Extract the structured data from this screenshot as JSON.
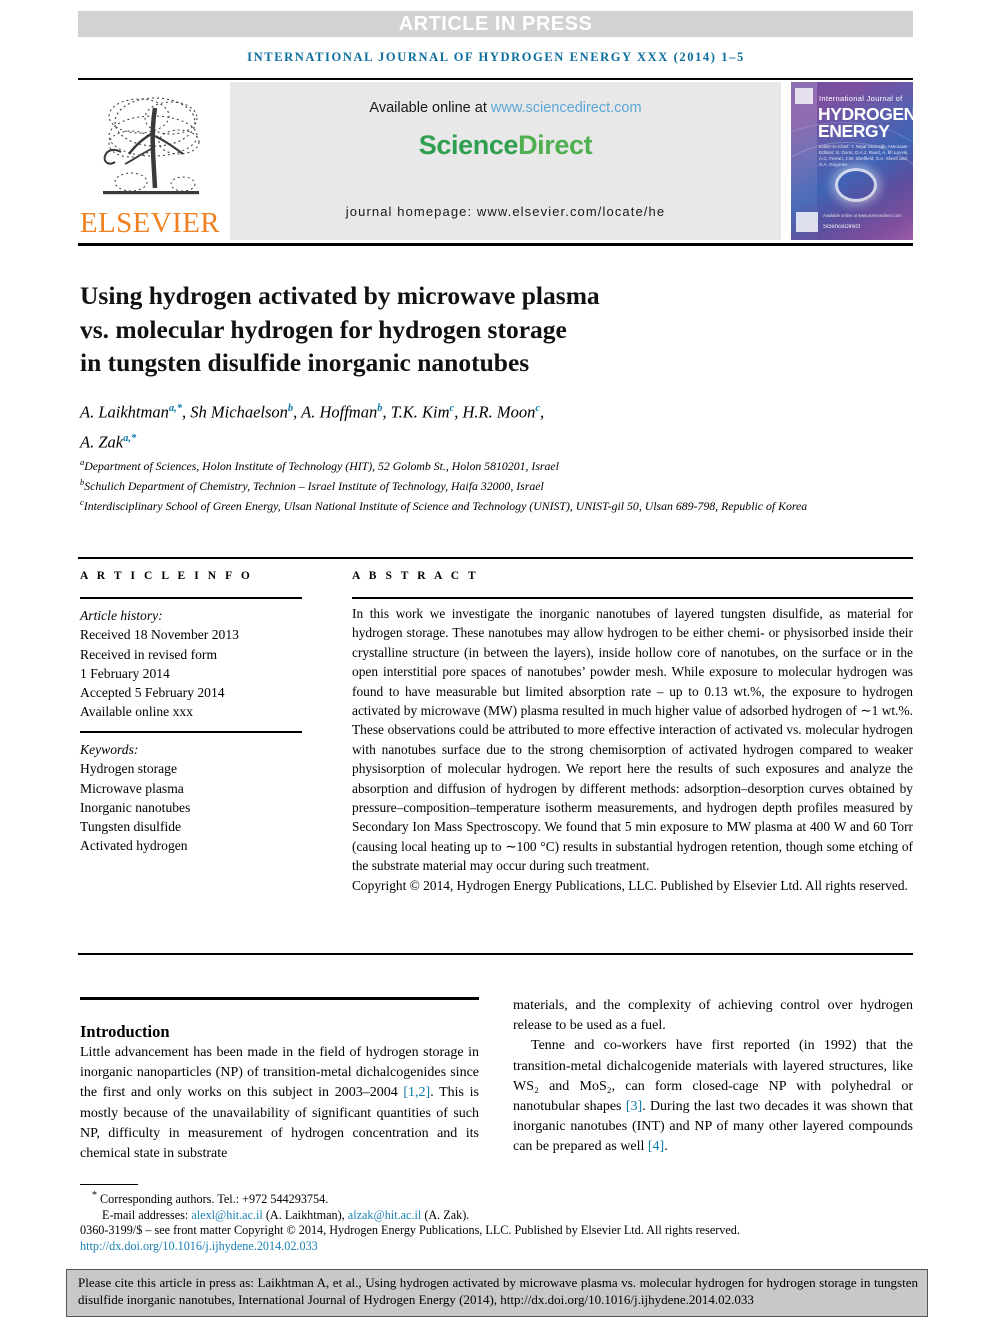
{
  "banner": {
    "article_in_press": "ARTICLE IN PRESS",
    "running_head": "INTERNATIONAL JOURNAL OF HYDROGEN ENERGY XXX (2014) 1–5"
  },
  "masthead": {
    "publisher_name": "ELSEVIER",
    "available_prefix": "Available online at ",
    "available_link": "www.sciencedirect.com",
    "brand_first": "Science",
    "brand_second": "Direct",
    "homepage": "journal homepage: www.elsevier.com/locate/he",
    "cover": {
      "eyebrow": "International Journal of",
      "title_line1": "HYDROGEN",
      "title_line2": "ENERGY",
      "meta": "Editor-in-Chief: T. Nejat Veziroğlu\nAssociate Editors: S. Dunn, D.A.J. Rand, A. M. Lovvik, A.C. Ferrari, J.W. Sheffield, S.A. Sherif and S.A. Grigoriev",
      "footer_brand": "ScienceDirect",
      "footer_note": "Available online at www.sciencedirect.com"
    }
  },
  "article": {
    "title_lines": [
      "Using hydrogen activated by microwave plasma",
      "vs. molecular hydrogen for hydrogen storage",
      "in tungsten disulfide inorganic nanotubes"
    ],
    "authors": [
      {
        "name": "A. Laikhtman",
        "marks": "a,*"
      },
      {
        "name": "Sh Michaelson",
        "marks": "b"
      },
      {
        "name": "A. Hoffman",
        "marks": "b"
      },
      {
        "name": "T.K. Kim",
        "marks": "c"
      },
      {
        "name": "H.R. Moon",
        "marks": "c"
      },
      {
        "name": "A. Zak",
        "marks": "a,*"
      }
    ],
    "affiliations": [
      {
        "mark": "a",
        "text": "Department of Sciences, Holon Institute of Technology (HIT), 52 Golomb St., Holon 5810201, Israel"
      },
      {
        "mark": "b",
        "text": "Schulich Department of Chemistry, Technion – Israel Institute of Technology, Haifa 32000, Israel"
      },
      {
        "mark": "c",
        "text": "Interdisciplinary School of Green Energy, Ulsan National Institute of Science and Technology (UNIST), UNIST-gil 50, Ulsan 689-798, Republic of Korea"
      }
    ]
  },
  "article_info": {
    "label": "A R T I C L E  I N F O",
    "history_header": "Article history:",
    "history_lines": [
      "Received 18 November 2013",
      "Received in revised form",
      "1 February 2014",
      "Accepted 5 February 2014",
      "Available online xxx"
    ],
    "keywords_header": "Keywords:",
    "keywords": [
      "Hydrogen storage",
      "Microwave plasma",
      "Inorganic nanotubes",
      "Tungsten disulfide",
      "Activated hydrogen"
    ]
  },
  "abstract": {
    "label": "A B S T R A C T",
    "body": "In this work we investigate the inorganic nanotubes of layered tungsten disulfide, as material for hydrogen storage. These nanotubes may allow hydrogen to be either chemi- or physisorbed inside their crystalline structure (in between the layers), inside hollow core of nanotubes, on the surface or in the open interstitial pore spaces of nanotubes’ powder mesh. While exposure to molecular hydrogen was found to have measurable but limited absorption rate – up to 0.13 wt.%, the exposure to hydrogen activated by microwave (MW) plasma resulted in much higher value of adsorbed hydrogen of ∼1 wt.%. These observations could be attributed to more effective interaction of activated vs. molecular hydrogen with nanotubes surface due to the strong chemisorption of activated hydrogen compared to weaker physisorption of molecular hydrogen. We report here the results of such exposures and analyze the absorption and diffusion of hydrogen by different methods: adsorption–desorption curves obtained by pressure–composition–temperature isotherm measurements, and hydrogen depth profiles measured by Secondary Ion Mass Spectroscopy. We found that 5 min exposure to MW plasma at 400 W and 60 Torr (causing local heating up to ∼100 °C) results in substantial hydrogen retention, though some etching of the substrate material may occur during such treatment.",
    "copyright": "Copyright © 2014, Hydrogen Energy Publications, LLC. Published by Elsevier Ltd. All rights reserved."
  },
  "introduction": {
    "heading": "Introduction",
    "left_paragraph_part1": "Little advancement has been made in the field of hydrogen storage in inorganic nanoparticles (NP) of transition-metal dichalcogenides since the first and only works on this subject in 2003–2004 ",
    "left_ref1": "[1,2]",
    "left_paragraph_part2": ". This is mostly because of the unavailability of significant quantities of such NP, difficulty in measurement of hydrogen concentration and its chemical state in substrate",
    "right_paragraph1": "materials, and the complexity of achieving control over hydrogen release to be used as a fuel.",
    "right_paragraph2_part1": "Tenne and co-workers have first reported (in 1992) that the transition-metal dichalcogenide materials with layered structures, like WS₂ and MoS₂, can form closed-cage NP with polyhedral or nanotubular shapes ",
    "right_ref3": "[3]",
    "right_paragraph2_part2": ". During the last two decades it was shown that inorganic nanotubes (INT) and NP of many other layered compounds can be prepared as well ",
    "right_ref4": "[4]",
    "right_paragraph2_part3": "."
  },
  "footer": {
    "corresponding": "Corresponding authors. Tel.: +972 544293754.",
    "email_label": "E-mail addresses: ",
    "email1": "alexl@hit.ac.il",
    "email1_owner": " (A. Laikhtman), ",
    "email2": "alzak@hit.ac.il",
    "email2_owner": " (A. Zak).",
    "issn_line": "0360-3199/$ – see front matter Copyright © 2014, Hydrogen Energy Publications, LLC. Published by Elsevier Ltd. All rights reserved.",
    "doi": "http://dx.doi.org/10.1016/j.ijhydene.2014.02.033"
  },
  "cite_box": {
    "text": "Please cite this article in press as: Laikhtman A, et al., Using hydrogen activated by microwave plasma vs. molecular hydrogen for hydrogen storage in tungsten disulfide inorganic nanotubes, International Journal of Hydrogen Energy (2014), http://dx.doi.org/10.1016/j.ijhydene.2014.02.033"
  },
  "colors": {
    "link_blue": "#1a7fb5",
    "running_head_blue": "#0b6d9e",
    "elsevier_orange": "#f08020",
    "sciencedirect_green": "#2e9e4f",
    "banner_gray": "#d2d2d2",
    "cite_box_gray": "#c8c8c8"
  }
}
